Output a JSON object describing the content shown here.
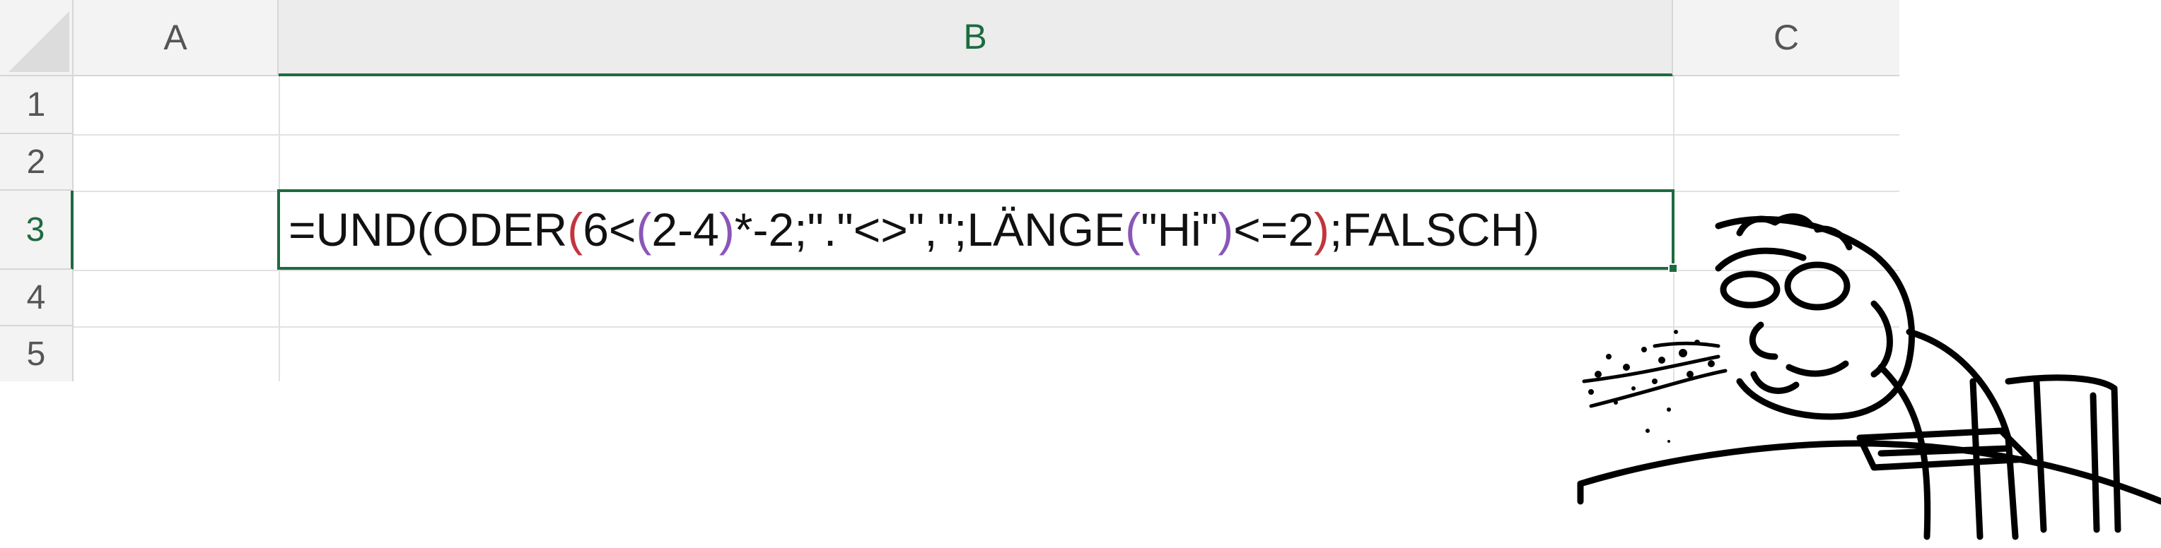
{
  "columns": [
    "A",
    "B",
    "C"
  ],
  "active_column": "B",
  "rows": [
    "1",
    "2",
    "3",
    "4",
    "5"
  ],
  "active_row": "3",
  "cell_b3": {
    "t1": "=UND(ODER",
    "p1": "(",
    "t2": "6<",
    "p2": "(",
    "t3": "2-4",
    "p3": ")",
    "t4": "*-2;\".\"<>\",\";LÄNGE",
    "p4": "(",
    "t5": "\"Hi\"",
    "p5": ")",
    "t6": "<=2",
    "p6": ")",
    "t7": ";FALSCH)"
  },
  "colors": {
    "accent": "#1d6b40",
    "paren_level1": "#c0363e",
    "paren_level2": "#8a56b9"
  },
  "overlay_image": "spitting-coffee-meme-face"
}
